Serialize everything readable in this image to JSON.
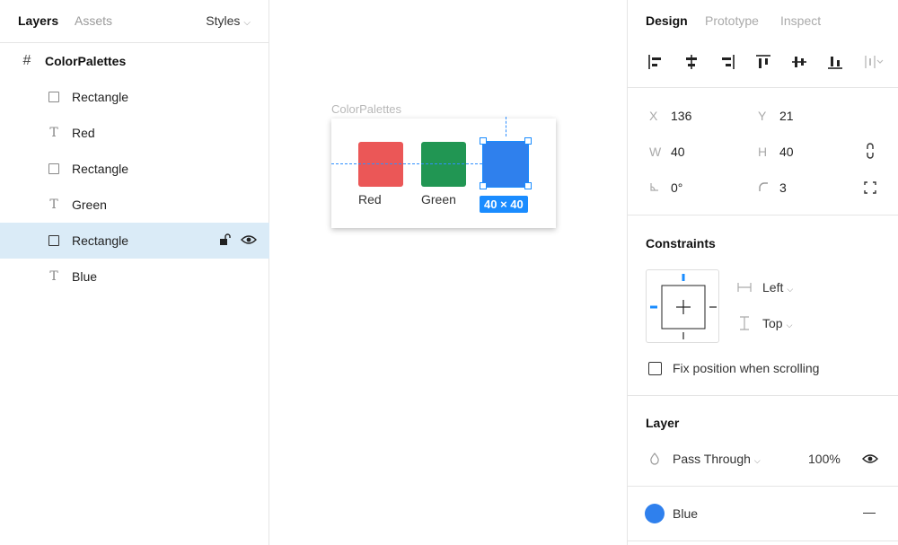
{
  "left_panel": {
    "tabs": [
      {
        "label": "Layers",
        "active": true
      },
      {
        "label": "Assets",
        "active": false
      }
    ],
    "styles_label": "Styles",
    "root_layer": {
      "label": "ColorPalettes",
      "icon": "frame-hash-icon"
    },
    "layers": [
      {
        "label": "Rectangle",
        "icon": "rectangle-icon",
        "selected": false
      },
      {
        "label": "Red",
        "icon": "text-icon",
        "selected": false
      },
      {
        "label": "Rectangle",
        "icon": "rectangle-icon",
        "selected": false
      },
      {
        "label": "Green",
        "icon": "text-icon",
        "selected": false
      },
      {
        "label": "Rectangle",
        "icon": "rectangle-icon",
        "selected": true
      },
      {
        "label": "Blue",
        "icon": "text-icon",
        "selected": false
      }
    ]
  },
  "canvas": {
    "frame_label": "ColorPalettes",
    "swatches": [
      {
        "label": "Red",
        "color": "#eb5757"
      },
      {
        "label": "Green",
        "color": "#219653"
      },
      {
        "label": "",
        "color": "#2f80ed"
      }
    ],
    "selection_dims": "40 × 40",
    "accent": "#1a8cff"
  },
  "right_panel": {
    "tabs": [
      {
        "label": "Design",
        "active": true
      },
      {
        "label": "Prototype",
        "active": false
      },
      {
        "label": "Inspect",
        "active": false
      }
    ],
    "props": {
      "x_label": "X",
      "x": "136",
      "y_label": "Y",
      "y": "21",
      "w_label": "W",
      "w": "40",
      "h_label": "H",
      "h": "40",
      "rotation": "0°",
      "radius": "3"
    },
    "constraints": {
      "title": "Constraints",
      "horizontal": "Left",
      "vertical": "Top",
      "fix_label": "Fix position when scrolling"
    },
    "layer": {
      "title": "Layer",
      "blend": "Pass Through",
      "opacity": "100%"
    },
    "fill": {
      "name": "Blue",
      "color": "#2f80ed"
    }
  }
}
